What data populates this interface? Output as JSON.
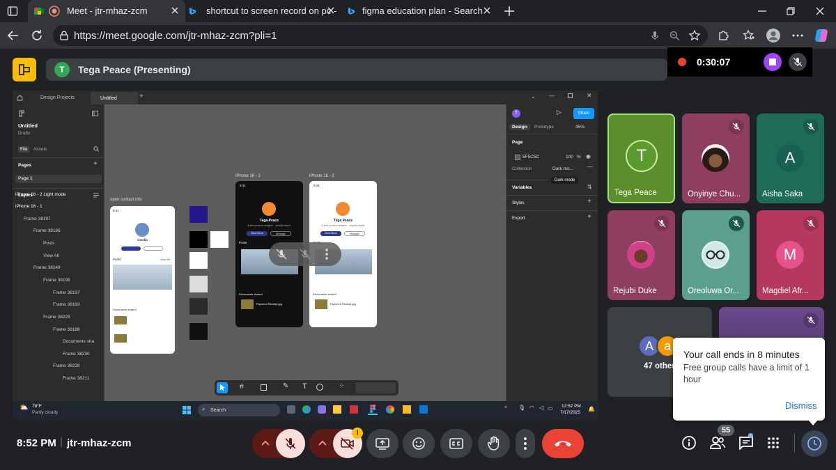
{
  "browser": {
    "tabs": [
      {
        "title": "Meet - jtr-mhaz-zcm",
        "active": true
      },
      {
        "title": "shortcut to screen record on pc -",
        "active": false
      },
      {
        "title": "figma education plan - Search",
        "active": false
      }
    ],
    "url": "https://meet.google.com/jtr-mhaz-zcm?pli=1"
  },
  "meet": {
    "presenter_initial": "T",
    "presenter_label": "Tega Peace (Presenting)",
    "recording_time": "0:30:07",
    "clock": "8:52 PM",
    "meeting_code": "jtr-mhaz-zcm",
    "participant_count": "55",
    "others_label": "47 others",
    "others_initials": [
      "A",
      "a"
    ],
    "participants": [
      {
        "name": "Tega Peace",
        "initial": "T"
      },
      {
        "name": "Onyinye Chu...",
        "initial": ""
      },
      {
        "name": "Aisha Saka",
        "initial": "A"
      },
      {
        "name": "Rejubi Duke",
        "initial": ""
      },
      {
        "name": "Oreoluwa Or...",
        "initial": ""
      },
      {
        "name": "Magdiel Afr...",
        "initial": "M"
      }
    ],
    "popup": {
      "title": "Your call ends in 8 minutes",
      "body": "Free group calls have a limit of 1 hour",
      "dismiss": "Dismiss"
    }
  },
  "figma": {
    "tabs": [
      "Design Projects",
      "Untitled"
    ],
    "file_name": "Untitled",
    "drafts": "Drafts",
    "file_tab": "File",
    "assets_tab": "Assets",
    "pages_label": "Pages",
    "page1": "Page 1",
    "layers_label": "Layers",
    "layers": [
      "iPhone 16 - 2  Light mode",
      "iPhone 16 - 1",
      "Frame 38197",
      "Frame 38188",
      "Posts",
      "View All",
      "Frame 38249",
      "Frame 38198",
      "Frame 38197",
      "Frame 38193",
      "Frame 38229",
      "Frame 38188",
      "Documents sha",
      "Frame 38230",
      "Frame 38228",
      "Frame 38211"
    ],
    "canvas_labels": {
      "open_contact": "open contact info",
      "iphone1": "iPhone 16 - 1",
      "iphone2": "iPhone 16 - 2"
    },
    "phone": {
      "time": "9:41",
      "name": "Tega Peace",
      "bio": "A tech product designer - shopify expert",
      "send_btn": "Send Move",
      "message_btn": "Message",
      "posts": "Posts",
      "view_all": "View All",
      "documents": "Documents shared",
      "doc_title": "Payment Receipt.jpg",
      "contact_name": "Cecilia"
    },
    "right": {
      "design_tab": "Design",
      "prototype_tab": "Prototype",
      "zoom": "45%",
      "share": "Share",
      "page_label": "Page",
      "page_color": "5F5C5C",
      "page_opacity": "100",
      "pct": "%",
      "collection_label": "Collection",
      "collection_value": "Dark mo...",
      "tooltip": "Dark mode",
      "variables": "Variables",
      "styles": "Styles",
      "export": "Export"
    }
  },
  "taskbar": {
    "weather_temp": "78°F",
    "weather_desc": "Partly cloudy",
    "search": "Search",
    "time": "12:52 PM",
    "date": "7/17/2025"
  },
  "colors": {
    "bg": "#202124",
    "meet_red": "#ea4335",
    "control_dark": "#3c4043",
    "mic_off_bg": "#f9dedc",
    "accent": "#8ab4f8",
    "record_purple": "#a142f4",
    "figma_blue": "#0d99ff"
  }
}
